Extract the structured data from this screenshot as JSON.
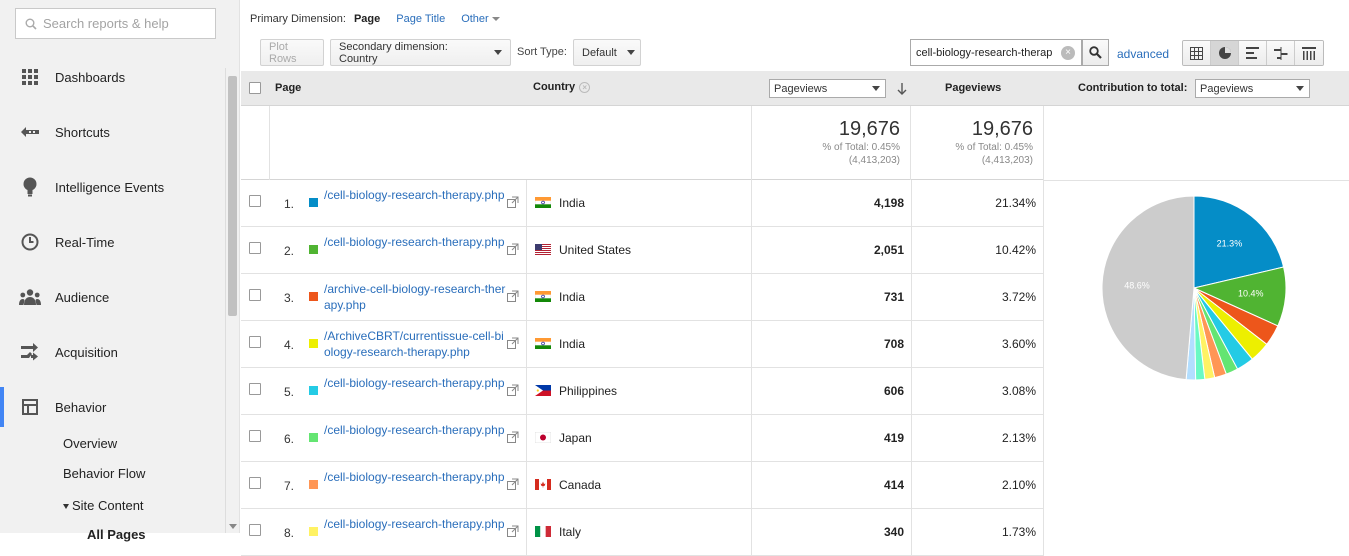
{
  "sidebar": {
    "search_placeholder": "Search reports & help",
    "nav": [
      {
        "label": "Dashboards",
        "icon": "dashboards-icon"
      },
      {
        "label": "Shortcuts",
        "icon": "shortcuts-icon"
      },
      {
        "label": "Intelligence Events",
        "icon": "lightbulb-icon"
      },
      {
        "label": "Real-Time",
        "icon": "clock-icon"
      },
      {
        "label": "Audience",
        "icon": "people-icon"
      },
      {
        "label": "Acquisition",
        "icon": "acquisition-icon"
      },
      {
        "label": "Behavior",
        "icon": "behavior-icon"
      }
    ],
    "sub": [
      "Overview",
      "Behavior Flow",
      "Site Content",
      "All Pages"
    ]
  },
  "primary_dimension": {
    "label": "Primary Dimension:",
    "options": [
      "Page",
      "Page Title",
      "Other"
    ]
  },
  "toolbar": {
    "plot_rows": "Plot Rows",
    "secondary_dimension": "Secondary dimension: Country",
    "sort_type_label": "Sort Type:",
    "sort_type_value": "Default",
    "filter_value": "cell-biology-research-therap",
    "advanced": "advanced"
  },
  "table": {
    "headers": {
      "page": "Page",
      "country": "Country",
      "metric_select": "Pageviews",
      "pageviews": "Pageviews",
      "contribution_label": "Contribution to total:",
      "contribution_select": "Pageviews"
    },
    "totals": {
      "value": "19,676",
      "pct_line": "% of Total: 0.45%",
      "total_line": "(4,413,203)"
    },
    "rows": [
      {
        "idx": "1.",
        "color": "#058dc7",
        "page": "/cell-biology-research-therapy.php",
        "flag": "in",
        "country": "India",
        "pageviews": "4,198",
        "pct": "21.34%"
      },
      {
        "idx": "2.",
        "color": "#50b432",
        "page": "/cell-biology-research-therapy.php",
        "flag": "us",
        "country": "United States",
        "pageviews": "2,051",
        "pct": "10.42%"
      },
      {
        "idx": "3.",
        "color": "#ed561b",
        "page": "/archive-cell-biology-research-therapy.php",
        "flag": "in",
        "country": "India",
        "pageviews": "731",
        "pct": "3.72%"
      },
      {
        "idx": "4.",
        "color": "#edef00",
        "page": "/ArchiveCBRT/currentissue-cell-biology-research-therapy.php",
        "flag": "in",
        "country": "India",
        "pageviews": "708",
        "pct": "3.60%"
      },
      {
        "idx": "5.",
        "color": "#24cbe5",
        "page": "/cell-biology-research-therapy.php",
        "flag": "ph",
        "country": "Philippines",
        "pageviews": "606",
        "pct": "3.08%"
      },
      {
        "idx": "6.",
        "color": "#64e572",
        "page": "/cell-biology-research-therapy.php",
        "flag": "jp",
        "country": "Japan",
        "pageviews": "419",
        "pct": "2.13%"
      },
      {
        "idx": "7.",
        "color": "#ff9655",
        "page": "/cell-biology-research-therapy.php",
        "flag": "ca",
        "country": "Canada",
        "pageviews": "414",
        "pct": "2.10%"
      },
      {
        "idx": "8.",
        "color": "#fff263",
        "page": "/cell-biology-research-therapy.php",
        "flag": "it",
        "country": "Italy",
        "pageviews": "340",
        "pct": "1.73%"
      }
    ]
  },
  "chart_data": {
    "type": "pie",
    "slices": [
      {
        "value": 21.34,
        "color": "#058dc7",
        "label": "21.3%"
      },
      {
        "value": 10.42,
        "color": "#50b432",
        "label": "10.4%"
      },
      {
        "value": 3.72,
        "color": "#ed561b",
        "label": ""
      },
      {
        "value": 3.6,
        "color": "#edef00",
        "label": ""
      },
      {
        "value": 3.08,
        "color": "#24cbe5",
        "label": ""
      },
      {
        "value": 2.13,
        "color": "#64e572",
        "label": ""
      },
      {
        "value": 2.1,
        "color": "#ff9655",
        "label": ""
      },
      {
        "value": 1.73,
        "color": "#fff263",
        "label": ""
      },
      {
        "value": 1.6,
        "color": "#6af9c4",
        "label": ""
      },
      {
        "value": 1.65,
        "color": "#b2deff",
        "label": ""
      },
      {
        "value": 48.63,
        "color": "#cccccc",
        "label": "48.6%"
      }
    ]
  }
}
